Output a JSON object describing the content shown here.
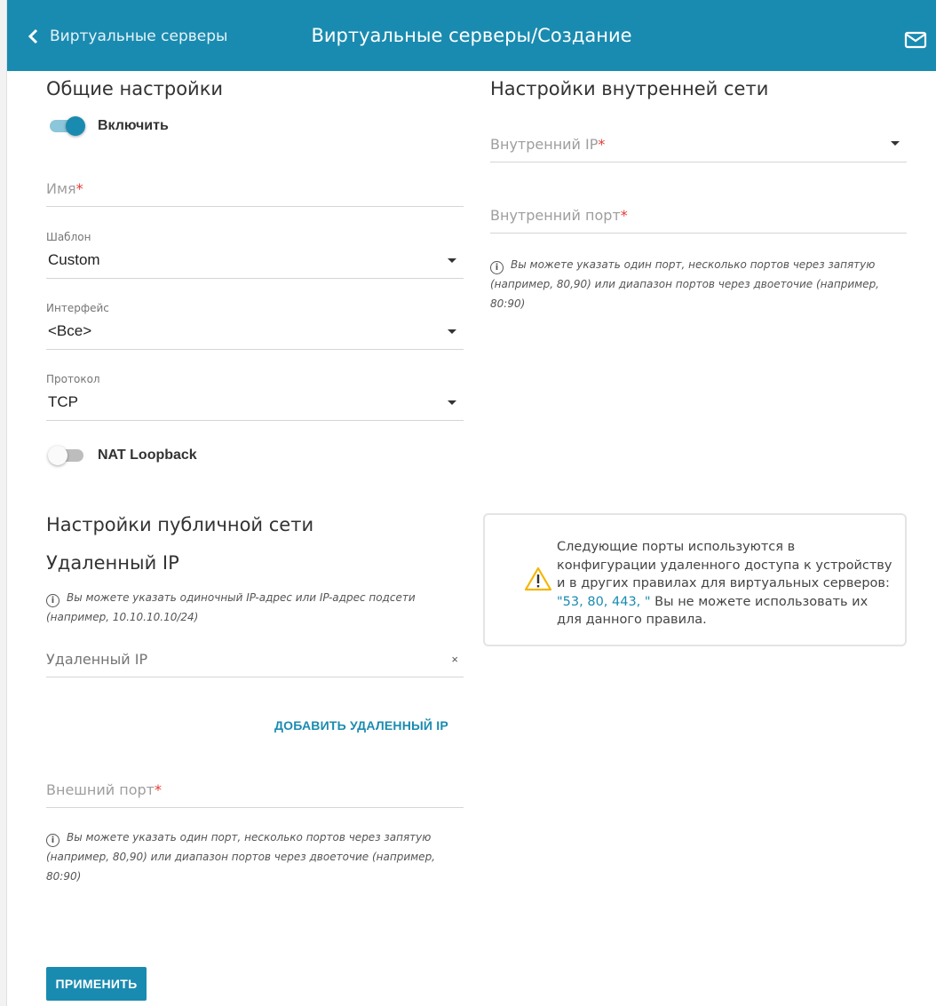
{
  "header": {
    "back_label": "Виртуальные серверы",
    "title": "Виртуальные серверы/Создание",
    "mail_icon": "mail-icon",
    "bg_color": "#1a8bb0"
  },
  "general": {
    "heading": "Общие настройки",
    "enable_label": "Включить",
    "enable_on": true,
    "name_placeholder": "Имя",
    "required_mark": "*",
    "template_label": "Шаблон",
    "template_value": "Custom",
    "interface_label": "Интерфейс",
    "interface_value": "<Все>",
    "protocol_label": "Протокол",
    "protocol_value": "TCP",
    "nat_loopback_label": "NAT Loopback",
    "nat_loopback_on": false
  },
  "public": {
    "heading": "Настройки публичной сети",
    "remote_ip_heading": "Удаленный IP",
    "remote_ip_hint": "Вы можете указать одиночный IP-адрес или IP-адрес подсети (например, 10.10.10.10/24)",
    "remote_ip_placeholder": "Удаленный IP",
    "clear_symbol": "×",
    "add_remote_ip": "ДОБАВИТЬ УДАЛЕННЫЙ IP",
    "external_port_placeholder": "Внешний порт",
    "external_port_hint": "Вы можете указать один порт, несколько портов через запятую (например, 80,90) или диапазон портов через двоеточие (например, 80:90)"
  },
  "internal": {
    "heading": "Настройки внутренней сети",
    "internal_ip_placeholder": "Внутренний IP",
    "internal_port_placeholder": "Внутренний порт",
    "internal_port_hint": "Вы можете указать один порт, несколько портов через запятую (например, 80,90) или диапазон портов через двоеточие (например, 80:90)"
  },
  "warning": {
    "text_before": "Следующие порты используются в конфигурации удаленного доступа к устройству и в других правилах для виртуальных серверов: ",
    "ports": "\"53, 80, 443, \"",
    "text_after": " Вы не можете использовать их для данного правила.",
    "icon": "warning-icon"
  },
  "apply_button": "ПРИМЕНИТЬ"
}
